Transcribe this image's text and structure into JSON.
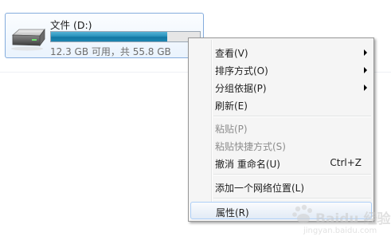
{
  "drive": {
    "name": "文件 (D:)",
    "free_text": "12.3 GB 可用，共 55.8 GB",
    "used_fraction": 0.78,
    "bar_color": "#1e88b4"
  },
  "context_menu": {
    "items": [
      {
        "label": "查看(V)",
        "submenu": true
      },
      {
        "label": "排序方式(O)",
        "submenu": true
      },
      {
        "label": "分组依据(P)",
        "submenu": true
      },
      {
        "label": "刷新(E)"
      },
      {
        "label": "粘贴(P)",
        "disabled": true
      },
      {
        "label": "粘贴快捷方式(S)",
        "disabled": true
      },
      {
        "label": "撤消 重命名(U)",
        "shortcut": "Ctrl+Z"
      },
      {
        "label": "添加一个网络位置(L)"
      },
      {
        "label": "属性(R)",
        "highlighted": true
      }
    ]
  },
  "watermark": {
    "logo": "Baidu 经验",
    "sub": "jingyan.baidu.com"
  }
}
